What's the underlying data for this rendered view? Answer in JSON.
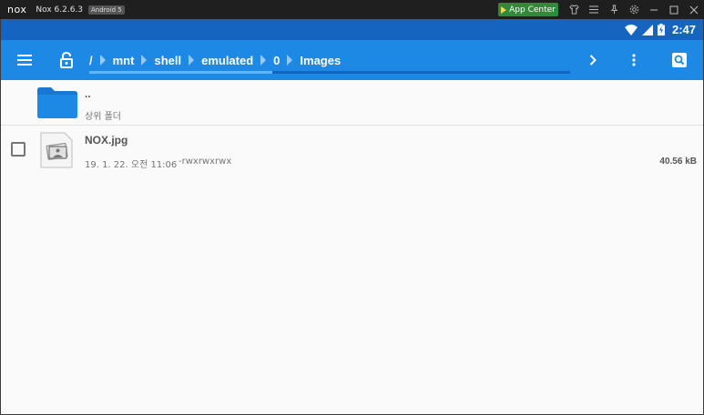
{
  "emulator": {
    "logo": "nox",
    "title": "Nox 6.2.6.3",
    "android_badge": "Android 5",
    "app_center_label": "App Center",
    "icons": [
      "shirt-icon",
      "menu-icon",
      "pin-icon",
      "gear-icon",
      "minimize-icon",
      "maximize-icon",
      "close-icon"
    ]
  },
  "status_bar": {
    "time": "2:47",
    "icons": [
      "wifi-icon",
      "signal-icon",
      "battery-icon"
    ]
  },
  "toolbar": {
    "breadcrumbs": [
      "/",
      "mnt",
      "shell",
      "emulated",
      "0",
      "Images"
    ],
    "path_scroll_fraction": 0.38,
    "colors": {
      "toolbar": "#1e88e5",
      "status_bar": "#1565c0"
    }
  },
  "list": {
    "parent": {
      "name": "..",
      "subtitle": "상위 폴더"
    },
    "files": [
      {
        "name": "NOX.jpg",
        "date": "19. 1. 22. 오전 11:06",
        "permissions": "-rwxrwxrwx",
        "size": "40.56 kB",
        "checked": false
      }
    ]
  }
}
